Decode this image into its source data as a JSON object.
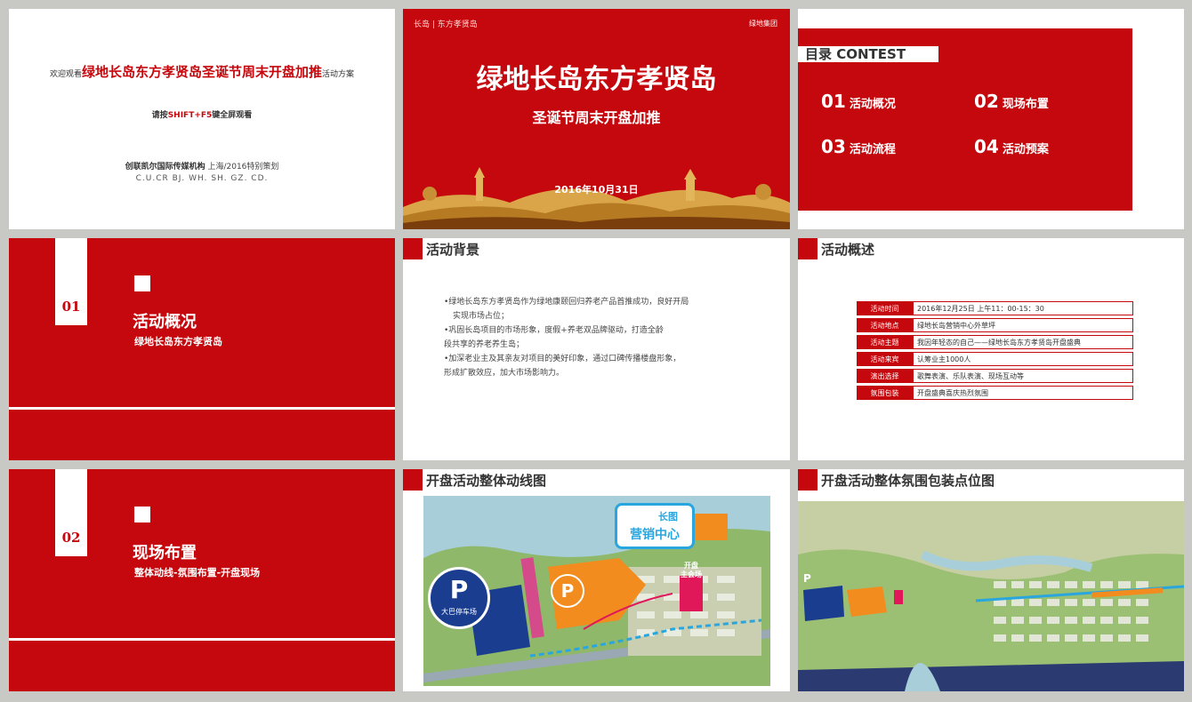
{
  "slide1": {
    "title_prefix": "欢迎观看",
    "title_main": "绿地长岛东方孝贤岛圣诞节周末开盘加推",
    "title_suffix": "活动方案",
    "hint_a": "请按",
    "hint_key": "SHIFT+F5",
    "hint_b": "键全屏观看",
    "agency_name": "创联凯尔国际传媒机构",
    "agency_plan": " 上海/2016特别策划",
    "cities": "C.U.CR  BJ.  WH.  SH.  GZ.  CD."
  },
  "slide2": {
    "logo_left": "长岛  |  东方孝贤岛",
    "logo_right": "绿地集团",
    "title": "绿地长岛东方孝贤岛",
    "subtitle": "圣诞节周末开盘加推",
    "date": "2016年10月31日"
  },
  "slide3": {
    "toc_title": "目录 CONTEST",
    "items": [
      {
        "num": "01",
        "label": "活动概况"
      },
      {
        "num": "02",
        "label": "现场布置"
      },
      {
        "num": "03",
        "label": "活动流程"
      },
      {
        "num": "04",
        "label": "活动预案"
      }
    ]
  },
  "slide4": {
    "num": "01",
    "title": "活动概况",
    "subtitle": "绿地长岛东方孝贤岛"
  },
  "slide5": {
    "title": "活动背景",
    "lines": [
      "•绿地长岛东方孝贤岛作为绿地康颐回归养老产品首推成功，良好开局",
      "实现市场占位；",
      "•巩固长岛项目的市场形象，度假+养老双品牌驱动，打造全龄",
      "段共享的养老养生岛；",
      "•加深老业主及其亲友对项目的美好印象，通过口碑传播楼盘形象，",
      "形成扩散效应，加大市场影响力。"
    ]
  },
  "slide6": {
    "title": "活动概述",
    "rows": [
      {
        "key": "活动时间",
        "value": "2016年12月25日 上午11：00-15：30"
      },
      {
        "key": "活动地点",
        "value": "绿地长岛营销中心外草坪"
      },
      {
        "key": "活动主题",
        "value": "我因年轻态的自己——绿地长岛东方孝贤岛开盘盛典"
      },
      {
        "key": "活动来宾",
        "value": "认筹业主1000人"
      },
      {
        "key": "演出选择",
        "value": "歌舞表演、乐队表演、现场互动等"
      },
      {
        "key": "氛围包装",
        "value": "开盘盛典喜庆热烈氛围"
      }
    ]
  },
  "slide7": {
    "num": "02",
    "title": "现场布置",
    "subtitle": "整体动线-氛围布置-开盘现场"
  },
  "slide8": {
    "title": "开盘活动整体动线图",
    "sales_center": "营销中心",
    "sales_logo": "长图",
    "parking_label": "大巴停车场",
    "opening_label": "开盘\n主会场",
    "parking_icon": "P"
  },
  "slide9": {
    "title": "开盘活动整体氛围包装点位图",
    "parking_icon": "P"
  }
}
